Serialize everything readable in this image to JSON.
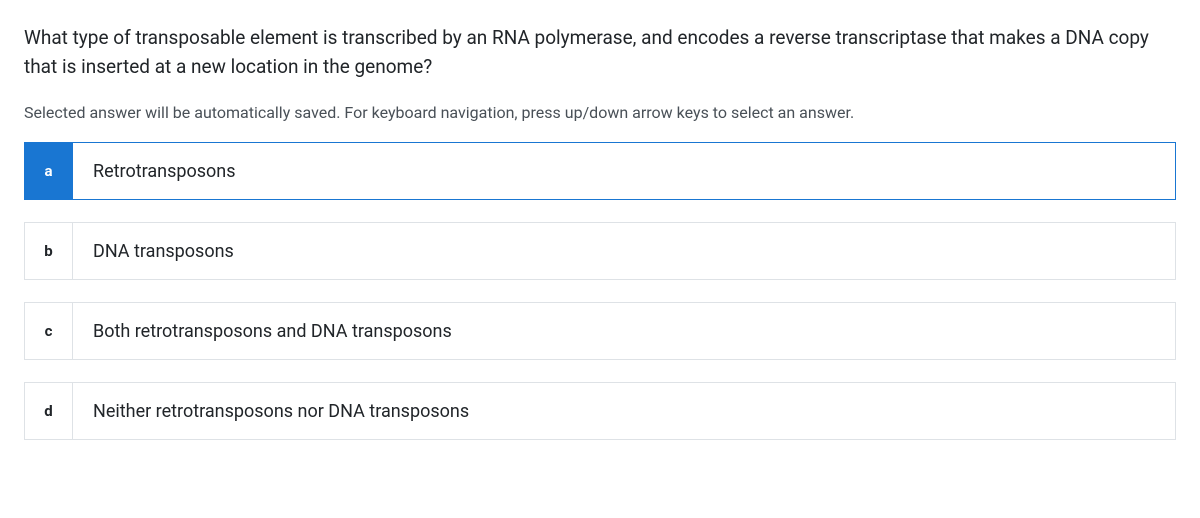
{
  "question": "What type of transposable element is transcribed by an RNA polymerase, and encodes a reverse transcriptase that makes a DNA copy that is inserted at a new location in the genome?",
  "instruction": "Selected answer will be automatically saved. For keyboard navigation, press up/down arrow keys to select an answer.",
  "options": [
    {
      "key": "a",
      "label": "Retrotransposons",
      "selected": true
    },
    {
      "key": "b",
      "label": "DNA transposons",
      "selected": false
    },
    {
      "key": "c",
      "label": "Both retrotransposons and DNA transposons",
      "selected": false
    },
    {
      "key": "d",
      "label": "Neither retrotransposons nor DNA transposons",
      "selected": false
    }
  ]
}
